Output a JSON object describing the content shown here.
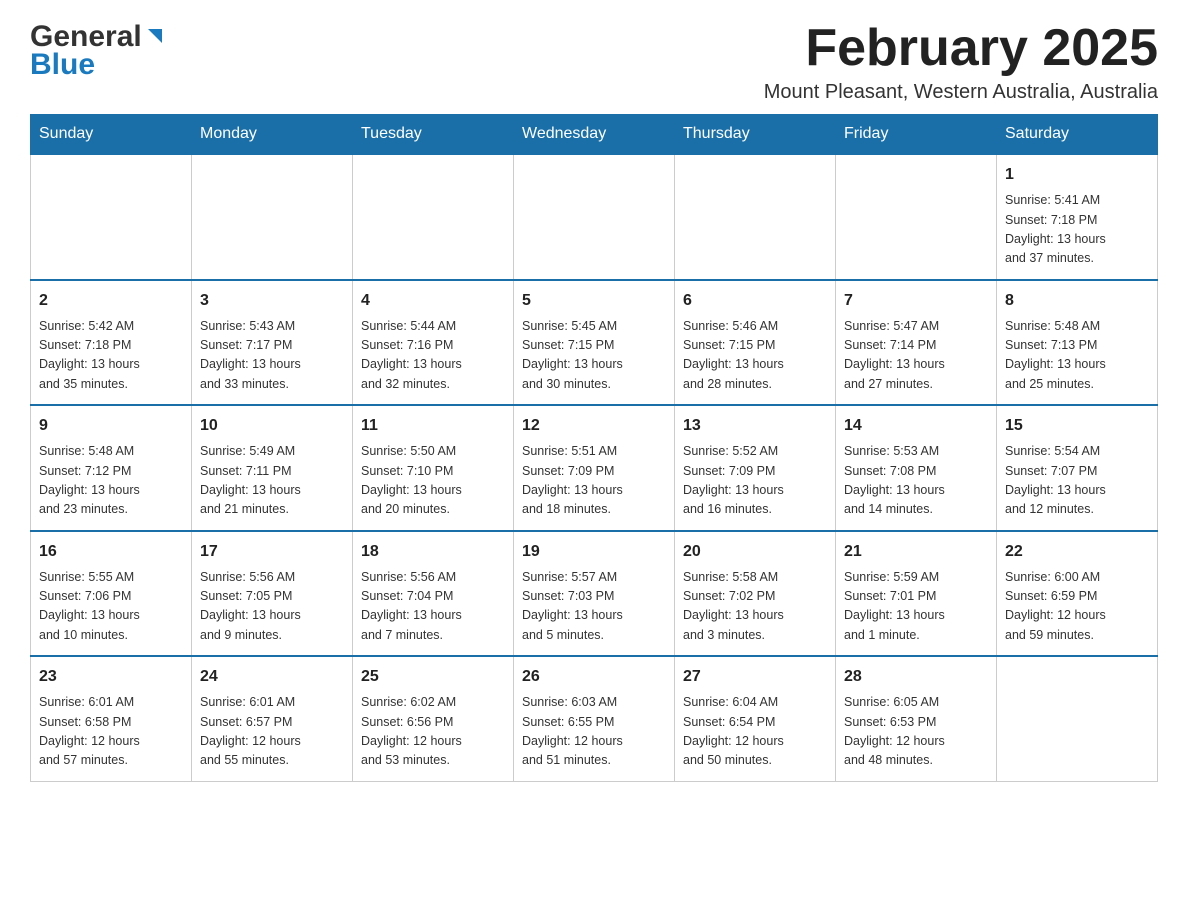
{
  "header": {
    "logo_general": "General",
    "logo_blue": "Blue",
    "month_title": "February 2025",
    "location": "Mount Pleasant, Western Australia, Australia"
  },
  "days_of_week": [
    "Sunday",
    "Monday",
    "Tuesday",
    "Wednesday",
    "Thursday",
    "Friday",
    "Saturday"
  ],
  "weeks": [
    [
      {
        "day": "",
        "info": ""
      },
      {
        "day": "",
        "info": ""
      },
      {
        "day": "",
        "info": ""
      },
      {
        "day": "",
        "info": ""
      },
      {
        "day": "",
        "info": ""
      },
      {
        "day": "",
        "info": ""
      },
      {
        "day": "1",
        "info": "Sunrise: 5:41 AM\nSunset: 7:18 PM\nDaylight: 13 hours\nand 37 minutes."
      }
    ],
    [
      {
        "day": "2",
        "info": "Sunrise: 5:42 AM\nSunset: 7:18 PM\nDaylight: 13 hours\nand 35 minutes."
      },
      {
        "day": "3",
        "info": "Sunrise: 5:43 AM\nSunset: 7:17 PM\nDaylight: 13 hours\nand 33 minutes."
      },
      {
        "day": "4",
        "info": "Sunrise: 5:44 AM\nSunset: 7:16 PM\nDaylight: 13 hours\nand 32 minutes."
      },
      {
        "day": "5",
        "info": "Sunrise: 5:45 AM\nSunset: 7:15 PM\nDaylight: 13 hours\nand 30 minutes."
      },
      {
        "day": "6",
        "info": "Sunrise: 5:46 AM\nSunset: 7:15 PM\nDaylight: 13 hours\nand 28 minutes."
      },
      {
        "day": "7",
        "info": "Sunrise: 5:47 AM\nSunset: 7:14 PM\nDaylight: 13 hours\nand 27 minutes."
      },
      {
        "day": "8",
        "info": "Sunrise: 5:48 AM\nSunset: 7:13 PM\nDaylight: 13 hours\nand 25 minutes."
      }
    ],
    [
      {
        "day": "9",
        "info": "Sunrise: 5:48 AM\nSunset: 7:12 PM\nDaylight: 13 hours\nand 23 minutes."
      },
      {
        "day": "10",
        "info": "Sunrise: 5:49 AM\nSunset: 7:11 PM\nDaylight: 13 hours\nand 21 minutes."
      },
      {
        "day": "11",
        "info": "Sunrise: 5:50 AM\nSunset: 7:10 PM\nDaylight: 13 hours\nand 20 minutes."
      },
      {
        "day": "12",
        "info": "Sunrise: 5:51 AM\nSunset: 7:09 PM\nDaylight: 13 hours\nand 18 minutes."
      },
      {
        "day": "13",
        "info": "Sunrise: 5:52 AM\nSunset: 7:09 PM\nDaylight: 13 hours\nand 16 minutes."
      },
      {
        "day": "14",
        "info": "Sunrise: 5:53 AM\nSunset: 7:08 PM\nDaylight: 13 hours\nand 14 minutes."
      },
      {
        "day": "15",
        "info": "Sunrise: 5:54 AM\nSunset: 7:07 PM\nDaylight: 13 hours\nand 12 minutes."
      }
    ],
    [
      {
        "day": "16",
        "info": "Sunrise: 5:55 AM\nSunset: 7:06 PM\nDaylight: 13 hours\nand 10 minutes."
      },
      {
        "day": "17",
        "info": "Sunrise: 5:56 AM\nSunset: 7:05 PM\nDaylight: 13 hours\nand 9 minutes."
      },
      {
        "day": "18",
        "info": "Sunrise: 5:56 AM\nSunset: 7:04 PM\nDaylight: 13 hours\nand 7 minutes."
      },
      {
        "day": "19",
        "info": "Sunrise: 5:57 AM\nSunset: 7:03 PM\nDaylight: 13 hours\nand 5 minutes."
      },
      {
        "day": "20",
        "info": "Sunrise: 5:58 AM\nSunset: 7:02 PM\nDaylight: 13 hours\nand 3 minutes."
      },
      {
        "day": "21",
        "info": "Sunrise: 5:59 AM\nSunset: 7:01 PM\nDaylight: 13 hours\nand 1 minute."
      },
      {
        "day": "22",
        "info": "Sunrise: 6:00 AM\nSunset: 6:59 PM\nDaylight: 12 hours\nand 59 minutes."
      }
    ],
    [
      {
        "day": "23",
        "info": "Sunrise: 6:01 AM\nSunset: 6:58 PM\nDaylight: 12 hours\nand 57 minutes."
      },
      {
        "day": "24",
        "info": "Sunrise: 6:01 AM\nSunset: 6:57 PM\nDaylight: 12 hours\nand 55 minutes."
      },
      {
        "day": "25",
        "info": "Sunrise: 6:02 AM\nSunset: 6:56 PM\nDaylight: 12 hours\nand 53 minutes."
      },
      {
        "day": "26",
        "info": "Sunrise: 6:03 AM\nSunset: 6:55 PM\nDaylight: 12 hours\nand 51 minutes."
      },
      {
        "day": "27",
        "info": "Sunrise: 6:04 AM\nSunset: 6:54 PM\nDaylight: 12 hours\nand 50 minutes."
      },
      {
        "day": "28",
        "info": "Sunrise: 6:05 AM\nSunset: 6:53 PM\nDaylight: 12 hours\nand 48 minutes."
      },
      {
        "day": "",
        "info": ""
      }
    ]
  ],
  "accent_color": "#1a6fa8"
}
